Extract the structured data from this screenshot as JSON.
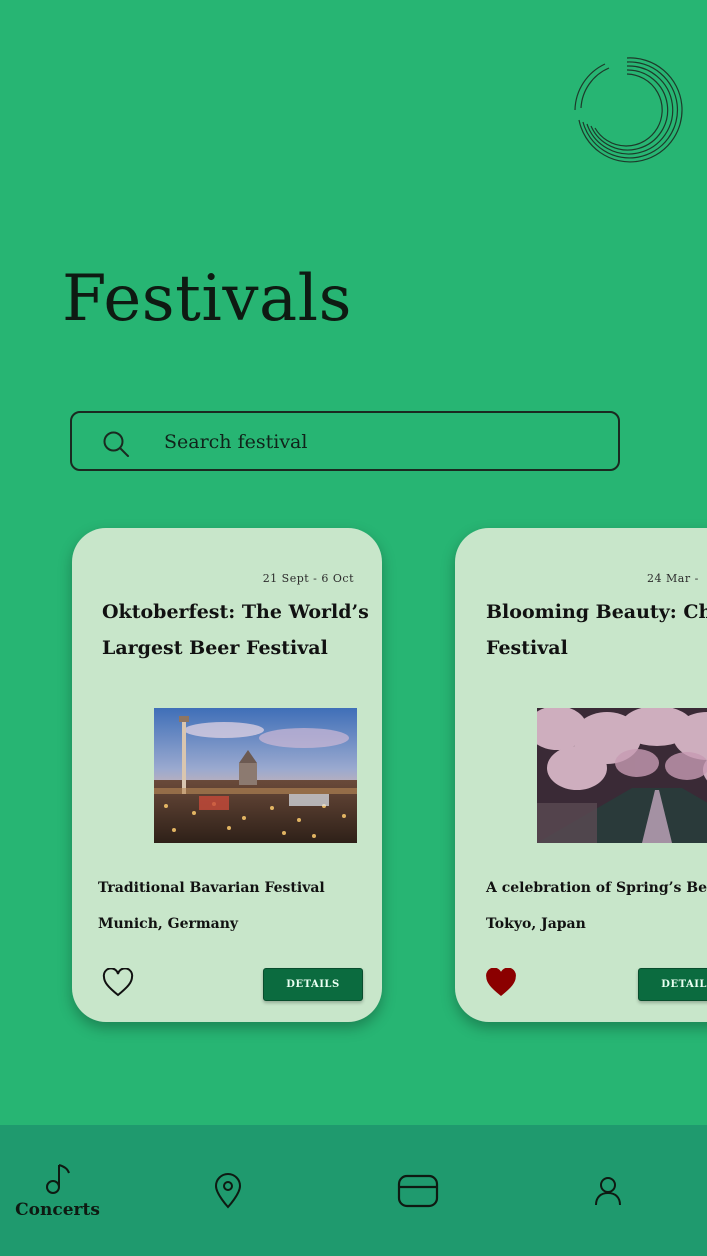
{
  "app": {
    "page_title": "Festivals",
    "brand_icon": "circle-lines-logo"
  },
  "search": {
    "placeholder": "Search festival",
    "icon": "search-icon"
  },
  "festivals": [
    {
      "date": "21 Sept - 6 Oct",
      "title": "Oktoberfest: The World’s Largest Beer Festival",
      "subtitle": "Traditional Bavarian Festival",
      "location": "Munich, Germany",
      "favorite": false,
      "details_label": "DETAILS",
      "image": "oktoberfest-fairground-photo"
    },
    {
      "date": "24 Mar - ",
      "title": "Blooming Beauty: Cherry Blossom Festival",
      "subtitle": "A celebration of Spring’s Beauty",
      "location": "Tokyo, Japan",
      "favorite": true,
      "details_label": "DETAILS",
      "image": "cherry-blossom-canal-photo"
    }
  ],
  "colors": {
    "background": "#27b573",
    "card": "#c8e6ca",
    "button": "#0b6b3f",
    "nav": "#1f9a6e",
    "heart_active": "#8b0000"
  },
  "nav": {
    "items": [
      {
        "label": "Concerts",
        "icon": "music-note-icon",
        "active": true
      },
      {
        "label": "",
        "icon": "location-pin-icon",
        "active": false
      },
      {
        "label": "",
        "icon": "ticket-card-icon",
        "active": false
      },
      {
        "label": "",
        "icon": "user-icon",
        "active": false
      }
    ]
  }
}
